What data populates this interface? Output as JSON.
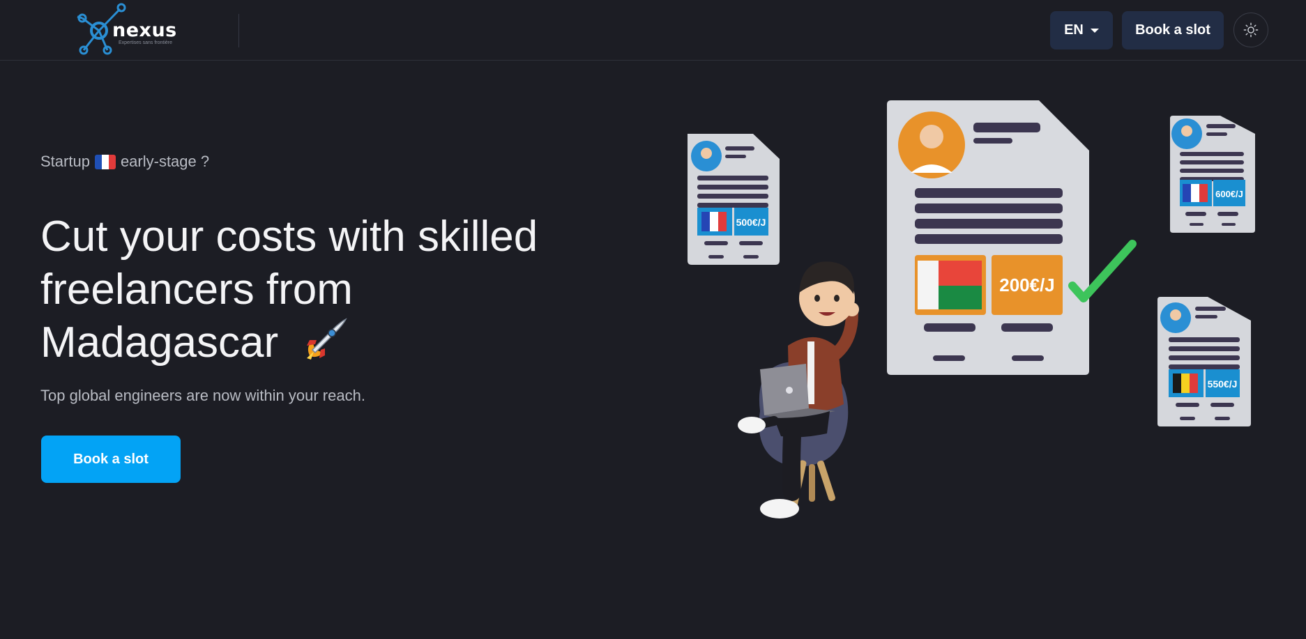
{
  "header": {
    "logo_text": "nexus",
    "logo_tagline": "Expertises sans frontière",
    "language_label": "EN",
    "book_label": "Book a slot",
    "theme_icon": "sun-icon"
  },
  "hero": {
    "eyebrow_before": "Startup",
    "eyebrow_after": "early-stage ?",
    "eyebrow_flag": "france-flag-icon",
    "headline": "Cut your costs with skilled freelancers from Madagascar",
    "headline_icon": "rocket-icon",
    "subtext": "Top global engineers are now within your reach.",
    "cta_label": "Book a slot"
  },
  "illustration": {
    "main_card_rate": "200€/J",
    "card_fr_left_rate": "500€/J",
    "card_fr_right_rate": "600€/J",
    "card_be_rate": "550€/J"
  },
  "colors": {
    "background": "#1c1d24",
    "accent": "#03a3f5",
    "header_button": "#222d45",
    "card_orange": "#e8922a",
    "card_blue": "#1a8fd0",
    "check_green": "#3dc45b"
  }
}
